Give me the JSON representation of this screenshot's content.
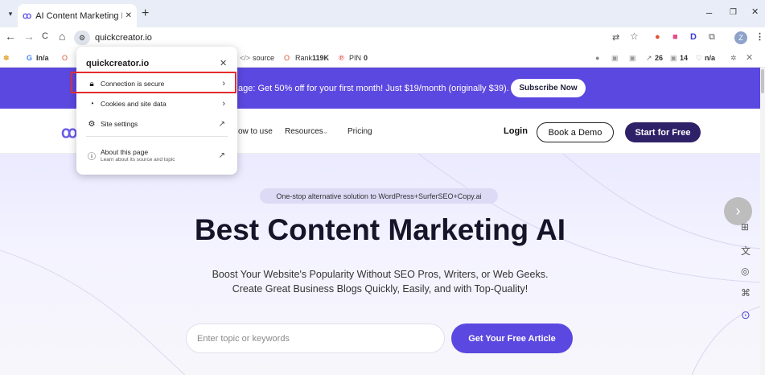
{
  "browser": {
    "tab": {
      "title": "AI Content Marketing Platform",
      "favicon": "quickcreator-logo-icon"
    },
    "new_tab": "+",
    "window": {
      "minimize": "–",
      "restore": "❐",
      "close": "✕"
    },
    "nav": {
      "back": "←",
      "forward": "→",
      "reload": "C",
      "home": "⌂"
    },
    "omnibox": {
      "url": "quickcreator.io"
    },
    "profile_initial": "Z"
  },
  "extension_bar": {
    "g_value": "In/a",
    "source_label": "source",
    "rank_label": "Rank",
    "rank_value": "119K",
    "pin_label": "PIN",
    "pin_value": "0",
    "links_value": "26",
    "pages_value": "14",
    "na_value": "n/a"
  },
  "site_info_popup": {
    "title": "quickcreator.io",
    "items": [
      {
        "label": "Connection is secure",
        "icon": "lock-icon"
      },
      {
        "label": "Cookies and site data",
        "icon": "cookie-icon"
      },
      {
        "label": "Site settings",
        "icon": "settings-sliders-icon"
      },
      {
        "label": "About this page",
        "sublabel": "Learn about its source and topic",
        "icon": "info-icon"
      }
    ]
  },
  "page": {
    "promo": {
      "text": "age: Get 50% off for your first month! Just $19/month (originally $39).",
      "button": "Subscribe Now"
    },
    "nav": {
      "links": [
        "ow to use",
        "Resources",
        "Pricing"
      ],
      "login": "Login",
      "demo": "Book a Demo",
      "start": "Start for Free"
    },
    "hero": {
      "pill": "One-stop alternative solution to WordPress+SurferSEO+Copy.ai",
      "title": "Best Content Marketing AI",
      "subtitle_line1": "Boost Your Website's Popularity Without SEO Pros, Writers, or Web Geeks.",
      "subtitle_line2": "Create Great Business Blogs Quickly, Easily, and with Top-Quality!",
      "input_placeholder": "Enter topic or keywords",
      "cta": "Get Your Free Article"
    }
  },
  "colors": {
    "brand_purple": "#5b48e0",
    "dark_button": "#2f2168",
    "highlight_red": "#e22d2d"
  }
}
